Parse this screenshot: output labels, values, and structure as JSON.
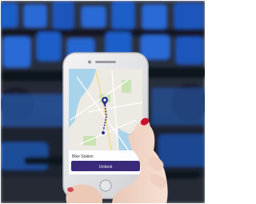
{
  "photo": {
    "subject": "hand holding smartphone with map app in front of docked blue bikes",
    "colors": {
      "bike_blue": "#1f5fc8",
      "bike_dark": "#1a1f2b",
      "phone_frame": "#e8e8ea",
      "nail_red": "#c8102e",
      "skin": "#f2d7c9",
      "map_land": "#eceae2",
      "map_water": "#a9d3ea",
      "map_park": "#c9e3b4",
      "app_bar": "#3b2a7a",
      "pin": "#2a2f8f"
    },
    "screen": {
      "button_label": "Unlock",
      "card_title": "Bike Station"
    }
  }
}
